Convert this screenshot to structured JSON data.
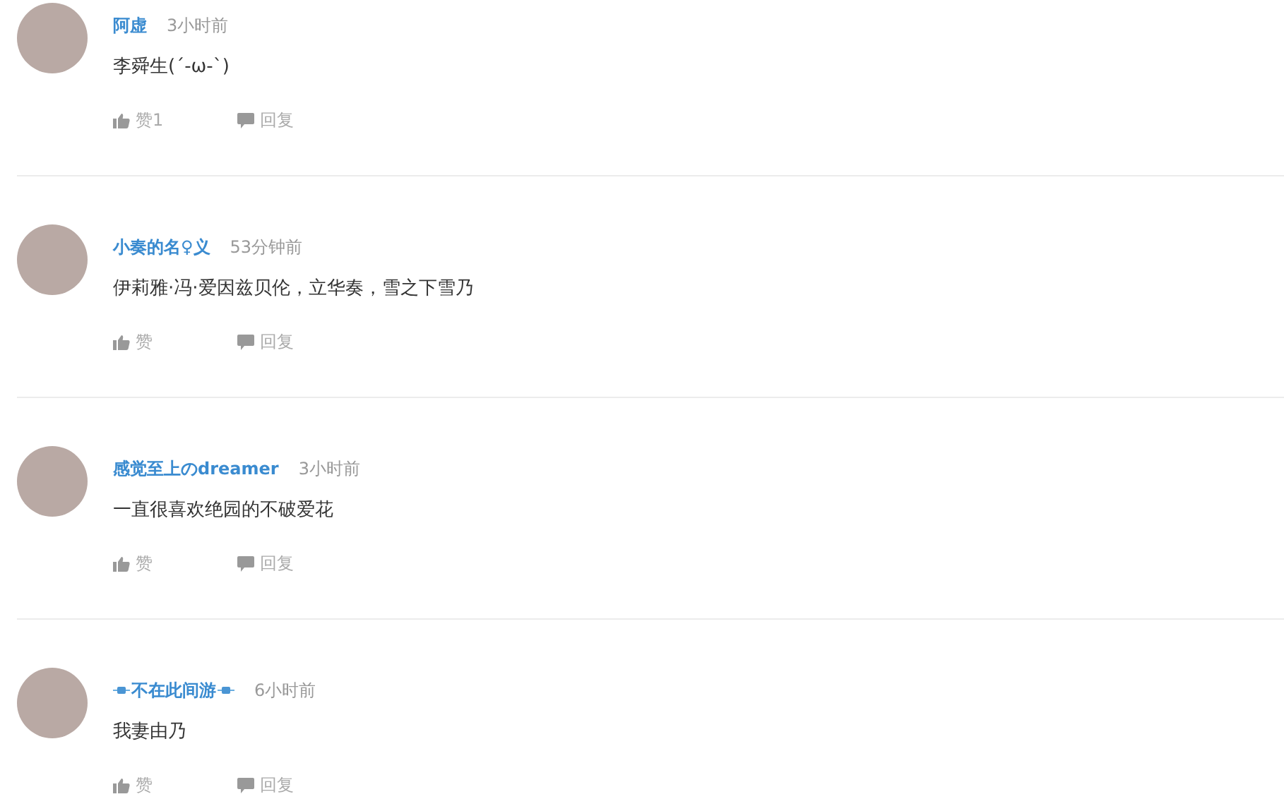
{
  "comments": [
    {
      "author": "阿虚",
      "ornamented": false,
      "time": "3小时前",
      "text": "李舜生(´-ω-`)",
      "like": "赞1",
      "reply": "回复"
    },
    {
      "author": "小奏的名♀义",
      "ornamented": false,
      "time": "53分钟前",
      "text": "伊莉雅·冯·爱因兹贝伦，立华奏，雪之下雪乃",
      "like": "赞",
      "reply": "回复"
    },
    {
      "author": "感觉至上のdreamer",
      "ornamented": false,
      "time": "3小时前",
      "text": "一直很喜欢绝园的不破爱花",
      "like": "赞",
      "reply": "回复"
    },
    {
      "author": "不在此间游",
      "ornamented": true,
      "time": "6小时前",
      "text": "我妻由乃",
      "like": "赞",
      "reply": "回复"
    }
  ]
}
